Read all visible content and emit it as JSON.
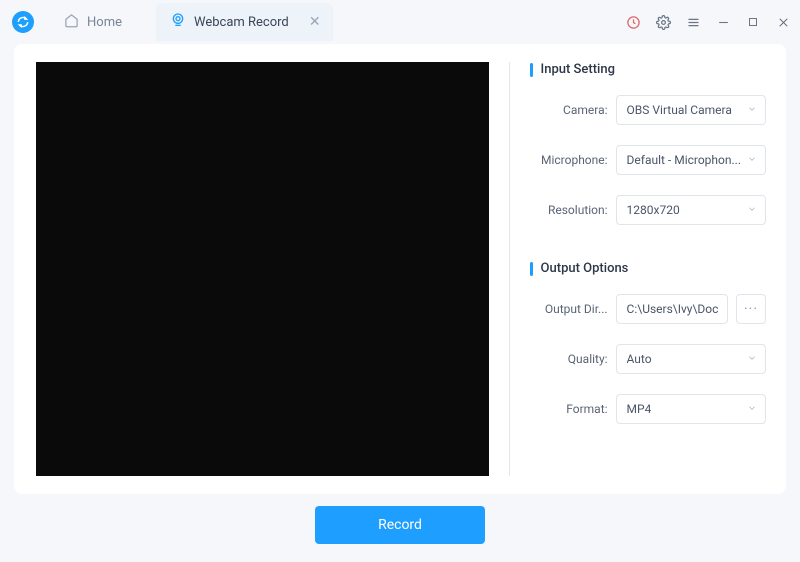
{
  "tabs": {
    "home_label": "Home",
    "active_label": "Webcam Record"
  },
  "input_section": {
    "title": "Input Setting",
    "camera_label": "Camera:",
    "camera_value": "OBS Virtual Camera",
    "microphone_label": "Microphone:",
    "microphone_value": "Default - Microphon...",
    "resolution_label": "Resolution:",
    "resolution_value": "1280x720"
  },
  "output_section": {
    "title": "Output Options",
    "dir_label": "Output Dir...",
    "dir_value": "C:\\Users\\Ivy\\Doc",
    "quality_label": "Quality:",
    "quality_value": "Auto",
    "format_label": "Format:",
    "format_value": "MP4"
  },
  "record_button": "Record"
}
